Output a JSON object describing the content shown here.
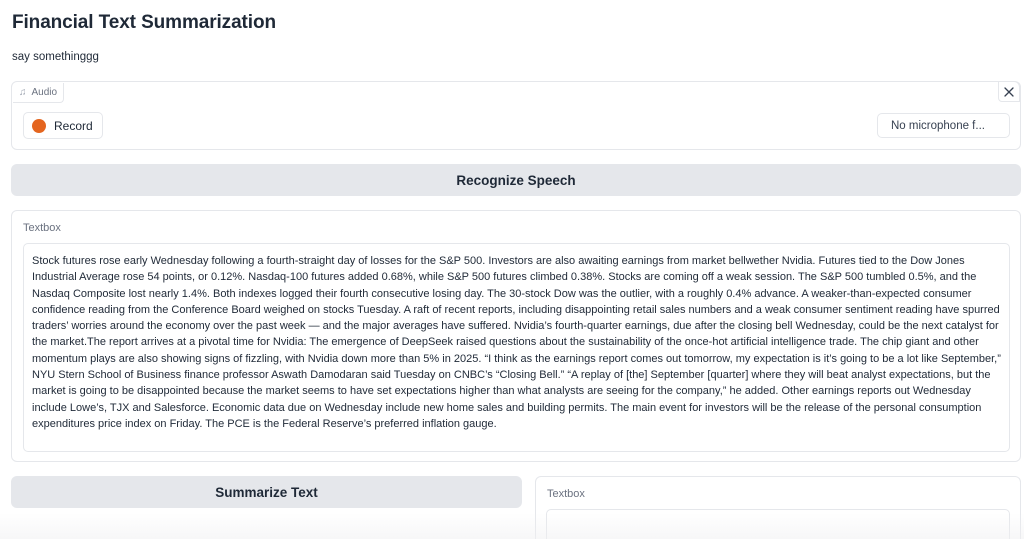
{
  "app": {
    "title": "Financial Text Summarization",
    "description": "say somethinggg"
  },
  "audio": {
    "label": "Audio",
    "label_icon": "music-note-icon",
    "record_label": "Record",
    "record_color": "#e4651f",
    "microphone_value": "No microphone f...",
    "close_icon": "close-icon"
  },
  "recognize": {
    "label": "Recognize Speech"
  },
  "input_textbox": {
    "label": "Textbox",
    "value": "Stock futures rose early Wednesday following a fourth-straight day of losses for the S&P 500. Investors are also awaiting earnings from market bellwether Nvidia. Futures tied to the Dow Jones Industrial Average rose 54 points, or 0.12%. Nasdaq-100 futures added 0.68%, while S&P 500 futures climbed 0.38%. Stocks are coming off a weak session. The S&P 500 tumbled 0.5%, and the Nasdaq Composite lost nearly 1.4%. Both indexes logged their fourth consecutive losing day. The 30-stock Dow was the outlier, with a roughly 0.4% advance. A weaker-than-expected consumer confidence reading from the Conference Board weighed on stocks Tuesday. A raft of recent reports, including disappointing retail sales numbers and a weak consumer sentiment reading have spurred traders’ worries around the economy over the past week — and the major averages have suffered. Nvidia’s fourth-quarter earnings, due after the closing bell Wednesday, could be the next catalyst for the market.The report arrives at a pivotal time for Nvidia: The emergence of DeepSeek raised questions about the sustainability of the once-hot artificial intelligence trade. The chip giant and other momentum plays are also showing signs of fizzling, with Nvidia down more than 5% in 2025. “I think as the earnings report comes out tomorrow, my expectation is it’s going to be a lot like September,” NYU Stern School of Business finance professor Aswath Damodaran said Tuesday on CNBC’s “Closing Bell.” “A replay of [the] September [quarter] where they will beat analyst expectations, but the market is going to be disappointed because the market seems to have set expectations higher than what analysts are seeing for the company,” he added. Other earnings reports out Wednesday include Lowe’s, TJX and Salesforce. Economic data due on Wednesday include new home sales and building permits. The main event for investors will be the release of the personal consumption expenditures price index on Friday. The PCE is the Federal Reserve’s preferred inflation gauge."
  },
  "summarize": {
    "label": "Summarize Text"
  },
  "output_textbox": {
    "label": "Textbox",
    "value": ""
  },
  "colors": {
    "button_bg": "#e5e7eb",
    "border": "#e5e7eb",
    "muted_text": "#6b7280"
  }
}
